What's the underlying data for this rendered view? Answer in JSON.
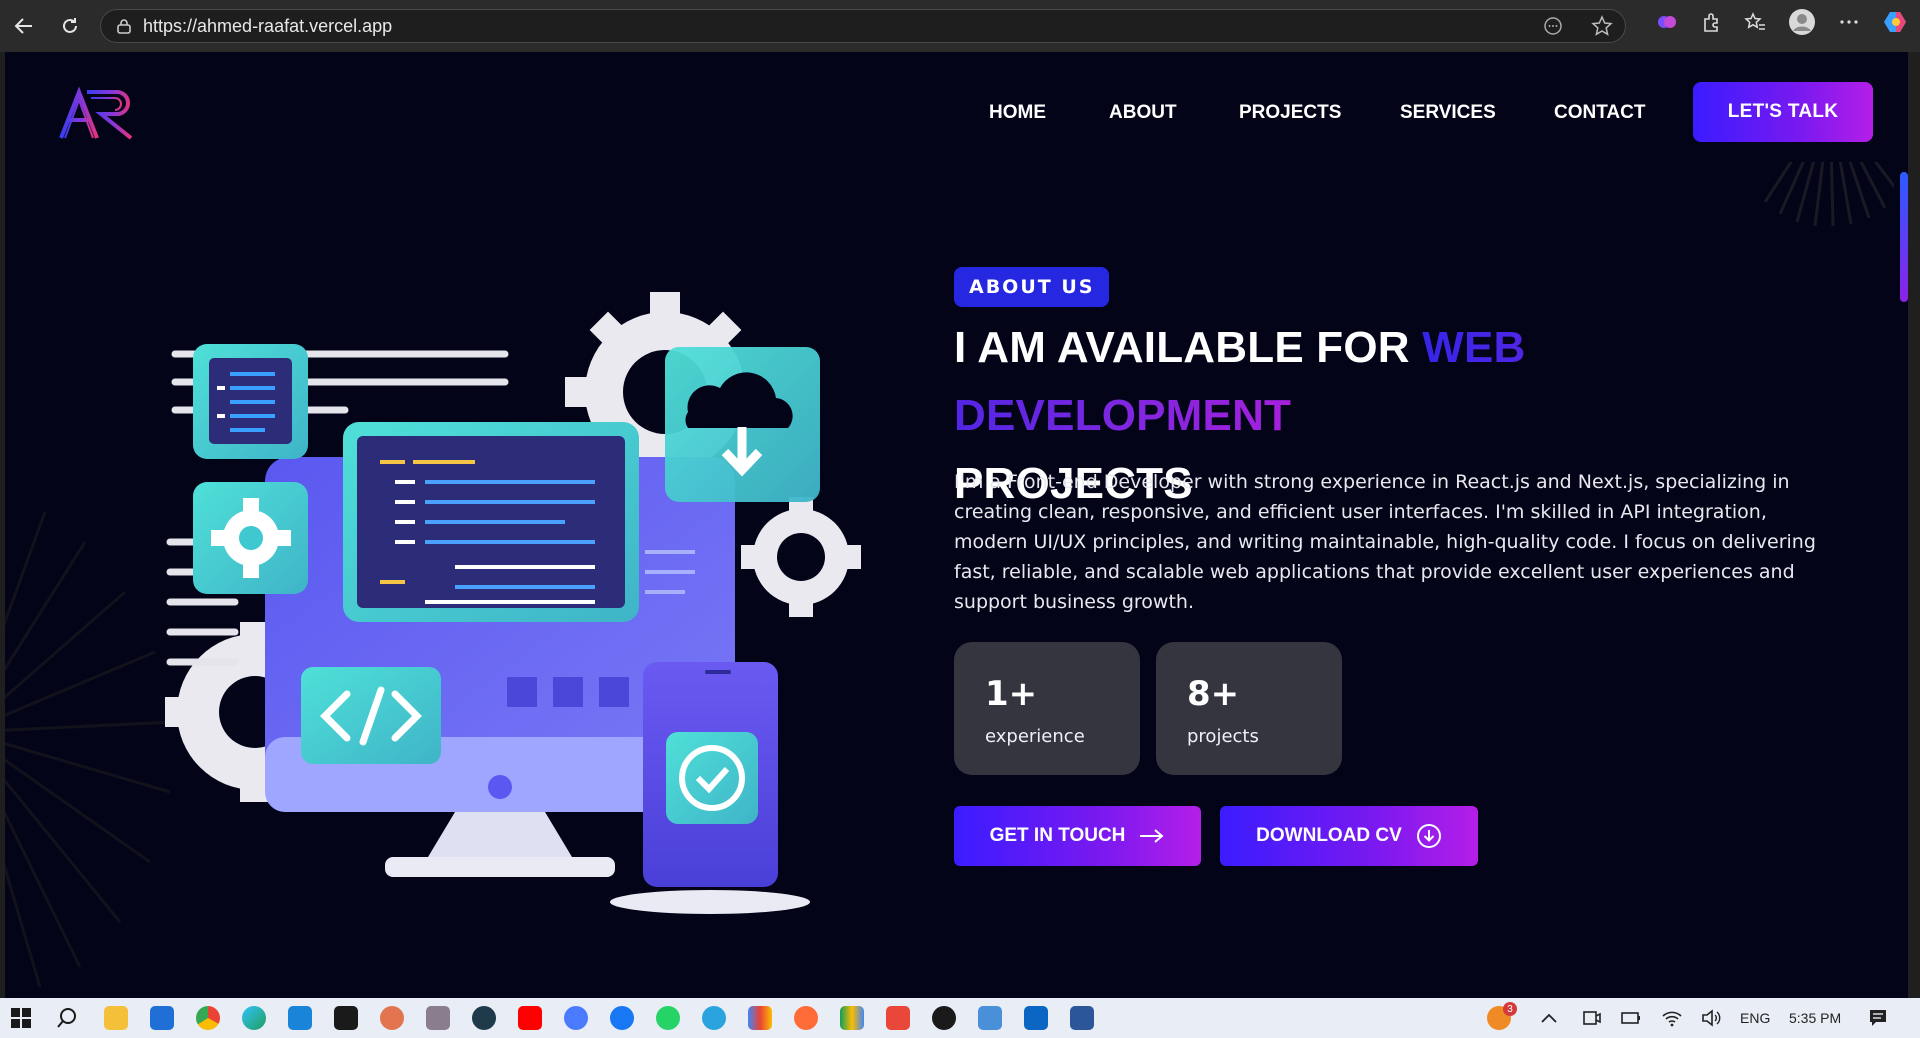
{
  "browser": {
    "url": "https://ahmed-raafat.vercel.app"
  },
  "header": {
    "logo_text": "AR",
    "nav": [
      "HOME",
      "ABOUT",
      "PROJECTS",
      "SERVICES",
      "CONTACT"
    ],
    "cta": "LET'S TALK"
  },
  "hero": {
    "tag": "ABOUT US",
    "headline_part1": "I AM AVAILABLE FOR ",
    "headline_highlight": "WEB DEVELOPMENT",
    "headline_part2": "PROJECTS",
    "paragraph": "I'm a Front-end Developer with strong experience in React.js and Next.js, specializing in creating clean, responsive, and efficient user interfaces. I'm skilled in API integration, modern UI/UX principles, and writing maintainable, high-quality code. I focus on delivering fast, reliable, and scalable web applications that provide excellent user experiences and support business growth.",
    "stats": [
      {
        "value": "1+",
        "label": "experience"
      },
      {
        "value": "8+",
        "label": "projects"
      }
    ],
    "buttons": {
      "primary": "GET IN TOUCH",
      "secondary": "DOWNLOAD CV"
    }
  },
  "taskbar": {
    "language": "ENG",
    "time": "5:35 PM",
    "notification_count": "3"
  },
  "colors": {
    "background": "#030418",
    "accent_start": "#3b1cff",
    "accent_end": "#b51ee8",
    "stat_card": "#34353f"
  }
}
